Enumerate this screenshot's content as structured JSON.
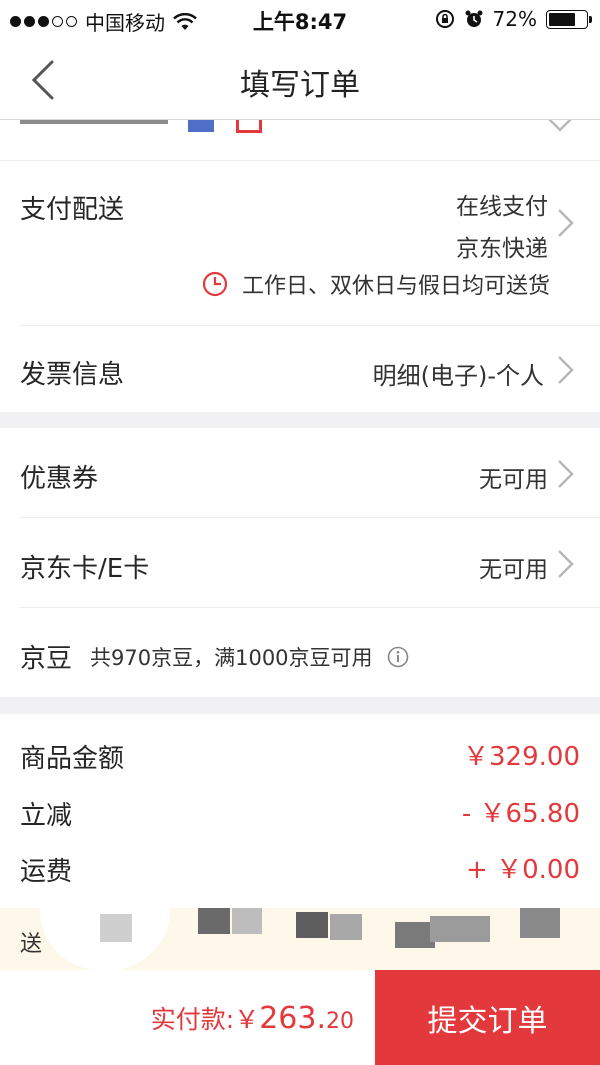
{
  "status_bar": {
    "carrier": "中国移动",
    "time": "上午8:47",
    "battery": "72%",
    "battery_level": 0.72
  },
  "navbar": {
    "title": "填写订单"
  },
  "payment_delivery": {
    "label": "支付配送",
    "payment": "在线支付",
    "delivery": "京东快递",
    "delivery_note": "工作日、双休日与假日均可送货"
  },
  "invoice": {
    "label": "发票信息",
    "value": "明细(电子)-个人"
  },
  "coupon": {
    "label": "优惠券",
    "value": "无可用"
  },
  "jd_card": {
    "label": "京东卡/E卡",
    "value": "无可用"
  },
  "jd_bean": {
    "label": "京豆",
    "desc": "共970京豆，满1000京豆可用"
  },
  "fees": {
    "goods_label": "商品金额",
    "goods_value": "￥329.00",
    "discount_label": "立减",
    "discount_value": "- ￥65.80",
    "shipping_label": "运费",
    "shipping_value": "+ ￥0.00"
  },
  "promo": {
    "text": "送"
  },
  "bottom": {
    "total_label": "实付款: ",
    "total_currency": "￥",
    "total_main": "263.",
    "total_cents": "20",
    "submit": "提交订单"
  },
  "colors": {
    "accent": "#e4393c",
    "background_gap": "#f1f1f3",
    "promo_bg": "#fdf8e9"
  }
}
